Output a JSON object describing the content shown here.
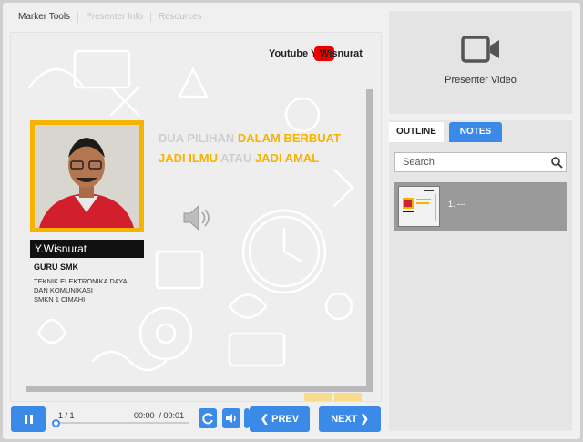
{
  "top_tabs": [
    "Marker Tools",
    "Presenter Info",
    "Resources"
  ],
  "slide": {
    "youtube_prefix": "Youtube Y.",
    "youtube_name": "Wisnurat",
    "presenter_name": "Y.Wisnurat",
    "role": "GURU SMK",
    "dept_line1": "TEKNIK ELEKTRONIKA DAYA",
    "dept_line2": "DAN KOMUNIKASI",
    "dept_line3": "SMKN 1 CIMAHI",
    "headline": {
      "w1": "DUA PILIHAN ",
      "w2": "DALAM BERBUAT",
      "w3": "JADI ILMU ",
      "w4": "ATAU ",
      "w5": "JADI AMAL"
    }
  },
  "player": {
    "slide_counter": "1  /  1",
    "time_current": "00:00",
    "time_total": "/ 00:01",
    "progress": 0.0,
    "prev_label": "PREV",
    "next_label": "NEXT"
  },
  "side": {
    "video_label": "Presenter Video",
    "tab_outline": "OUTLINE",
    "tab_notes": "NOTES",
    "search_placeholder": "Search",
    "outline_items": [
      {
        "label": "1. ---"
      }
    ]
  },
  "colors": {
    "accent": "#3c8ae8",
    "gold": "#f4b400"
  },
  "icons": [
    "pause-icon",
    "replay-icon",
    "volume-icon",
    "video-camera-icon",
    "search-icon",
    "speaker-icon"
  ]
}
